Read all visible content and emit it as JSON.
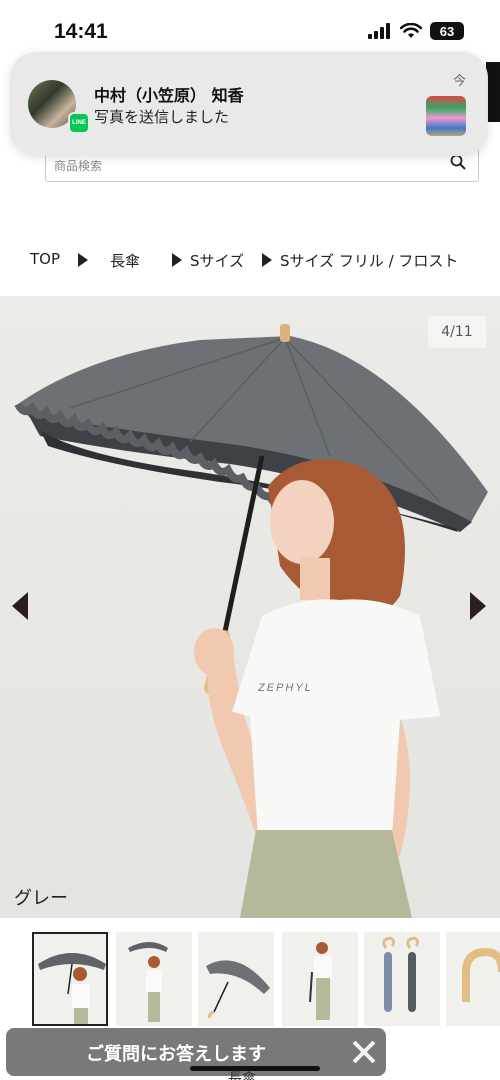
{
  "status_bar": {
    "time": "14:41",
    "battery": "63",
    "icons": [
      "signal-icon",
      "wifi-icon",
      "battery-icon"
    ]
  },
  "notification": {
    "sender": "中村（小笠原） 知香",
    "message": "写真を送信しました",
    "time": "今",
    "app_icon": "line-app-icon"
  },
  "search": {
    "placeholder": "商品検索"
  },
  "breadcrumb": {
    "items": [
      "TOP",
      "長傘",
      "Sサイズ",
      "Sサイズ フリル / フロスト"
    ]
  },
  "gallery": {
    "counter": "4/11",
    "color_label": "グレー",
    "shirt_text": "ZEPHYL",
    "colors": {
      "canopy": "#6d7175",
      "canopy_dark": "#4a4e52",
      "background": "#e9e9e6"
    }
  },
  "thumbnails": {
    "count_visible": 6,
    "active_index": 0
  },
  "chat": {
    "label": "ご質問にお答えします"
  },
  "partial_bottom_text": "長傘"
}
